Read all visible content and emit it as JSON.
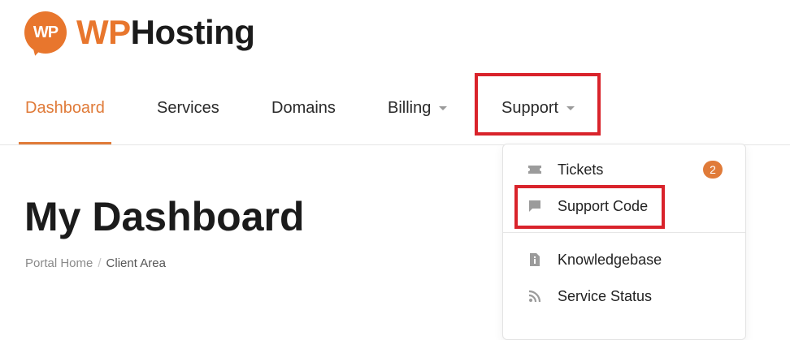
{
  "brand": {
    "mark_text": "WP",
    "name_accent": "WP",
    "name_rest": "Hosting"
  },
  "nav": {
    "dashboard": "Dashboard",
    "services": "Services",
    "domains": "Domains",
    "billing": "Billing",
    "support": "Support"
  },
  "page": {
    "title": "My Dashboard",
    "breadcrumb": {
      "home": "Portal Home",
      "separator": "/",
      "current": "Client Area"
    }
  },
  "support_menu": {
    "tickets": {
      "label": "Tickets",
      "badge": "2"
    },
    "support_code": {
      "label": "Support Code"
    },
    "knowledgebase": {
      "label": "Knowledgebase"
    },
    "service_status": {
      "label": "Service Status"
    }
  },
  "colors": {
    "accent": "#e07b39",
    "highlight": "#d9232b",
    "icon": "#9b9b9b"
  }
}
